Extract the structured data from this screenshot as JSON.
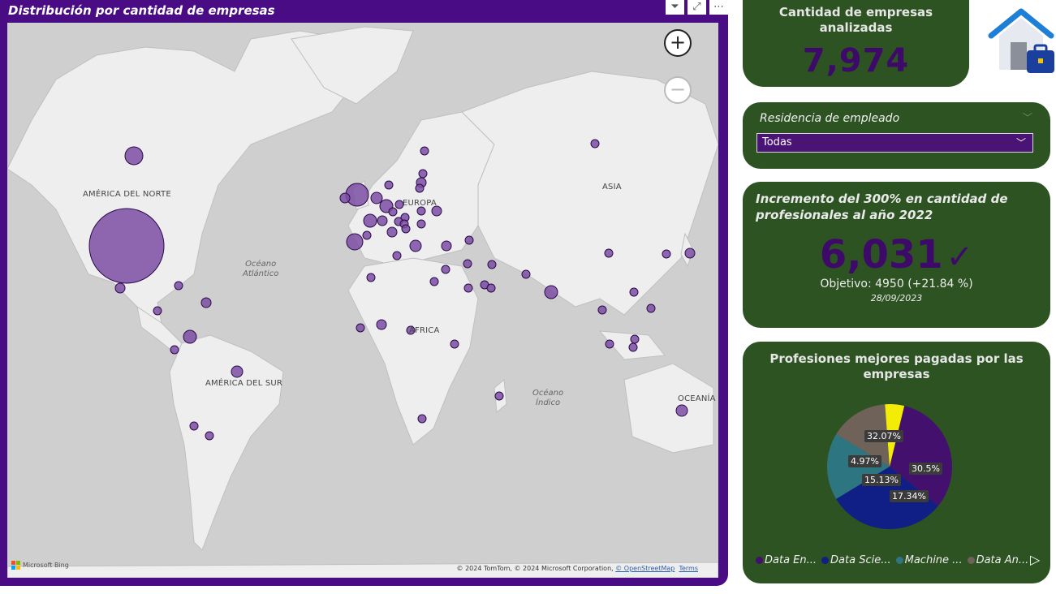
{
  "map": {
    "title": "Distribución por cantidad de empresas",
    "labels": {
      "north_america": "AMÉRICA DEL NORTE",
      "europe": "EUROPA",
      "asia": "ASIA",
      "africa": "ÁFRICA",
      "south_america": "AMÉRICA DEL SUR",
      "oceania": "OCEANÍA",
      "atlantic": "Océano\nAtlántico",
      "indian": "Océano\nÍndico"
    },
    "bing_label": "Microsoft Bing",
    "copyright": "© 2024 TomTom, © 2024 Microsoft Corporation,",
    "osm_link": "© OpenStreetMap",
    "terms_link": "Terms",
    "bubble_color": "#7b4ea3"
  },
  "kpi_companies": {
    "title": "Cantidad de empresas analizadas",
    "value": "7,974"
  },
  "slicer": {
    "label": "Residencia de empleado",
    "selected": "Todas"
  },
  "kpi_growth": {
    "title": "Incremento del 300% en cantidad de profesionales al año 2022",
    "value": "6,031",
    "goal": "Objetivo: 4950 (+21.84 %)",
    "date": "28/09/2023"
  },
  "pie_chart": {
    "title": "Profesiones mejores pagadas por las empresas",
    "slices": [
      {
        "label": "Data En...",
        "value": 32.07,
        "pct_label": "32.07%",
        "color": "#43106e"
      },
      {
        "label": "Data Scie...",
        "value": 30.5,
        "pct_label": "30.5%",
        "color": "#0f1f85"
      },
      {
        "label": "Machine ...",
        "value": 17.34,
        "pct_label": "17.34%",
        "color": "#2e7582"
      },
      {
        "label": "Data An...",
        "value": 15.13,
        "pct_label": "15.13%",
        "color": "#6e6259"
      },
      {
        "label": "",
        "value": 4.97,
        "pct_label": "4.97%",
        "color": "#f2ec06"
      }
    ]
  }
}
